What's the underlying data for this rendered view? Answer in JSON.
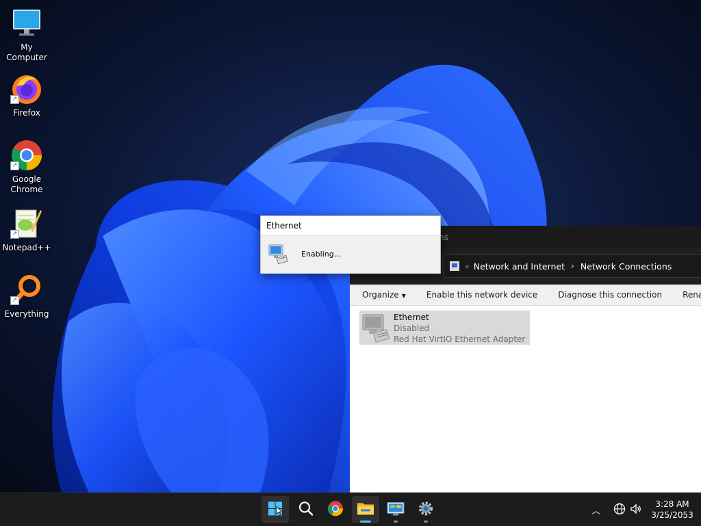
{
  "desktop": {
    "icons": [
      {
        "label": "My Computer",
        "icon": "monitor-icon"
      },
      {
        "label": "Firefox",
        "icon": "firefox-icon"
      },
      {
        "label": "Google Chrome",
        "icon": "chrome-icon"
      },
      {
        "label": "Notepad++",
        "icon": "notepadpp-icon"
      },
      {
        "label": "Everything",
        "icon": "everything-search-icon"
      }
    ]
  },
  "explorer": {
    "title_partial": "ns",
    "breadcrumb": [
      "Network and Internet",
      "Network Connections"
    ],
    "commands": {
      "organize": "Organize",
      "enable": "Enable this network device",
      "diagnose": "Diagnose this connection",
      "rename": "Rename this c"
    },
    "adapter": {
      "name": "Ethernet",
      "status": "Disabled",
      "device": "Red Hat VirtIO Ethernet Adapter"
    }
  },
  "popup": {
    "title": "Ethernet",
    "status": "Enabling..."
  },
  "taskbar": {
    "apps": [
      "start",
      "search",
      "chrome",
      "file-explorer",
      "control-panel",
      "settings"
    ],
    "clock": {
      "time": "3:28 AM",
      "date": "3/25/2053"
    }
  },
  "colors": {
    "accent": "#4cc2ff",
    "taskbar": "#1c1c1c",
    "wallpaper_bloom": "#1f5bff"
  }
}
